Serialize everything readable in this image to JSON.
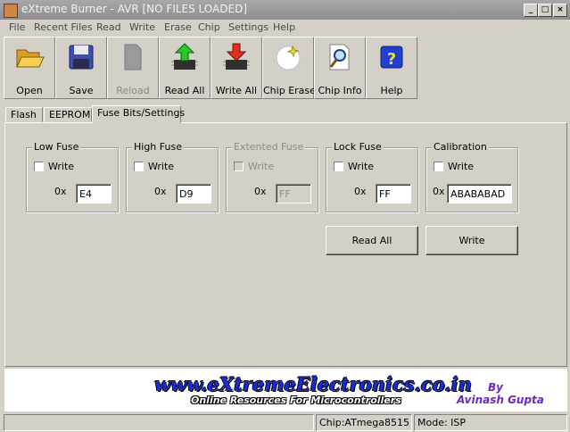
{
  "window": {
    "title": "eXtreme Burner - AVR [NO FILES LOADED]"
  },
  "menu": [
    "File",
    "Recent Files",
    "Read",
    "Write",
    "Erase",
    "Chip",
    "Settings",
    "Help"
  ],
  "toolbar": {
    "open": "Open",
    "save": "Save",
    "reload": "Reload",
    "read_all": "Read All",
    "write_all": "Write All",
    "chip_erase": "Chip Erase",
    "chip_info": "Chip Info",
    "help": "Help"
  },
  "tabs": [
    "Flash",
    "EEPROM",
    "Fuse Bits/Settings"
  ],
  "fuses": [
    {
      "title": "Low Fuse",
      "write_label": "Write",
      "prefix": "0x",
      "value": "E4",
      "enabled": true
    },
    {
      "title": "High Fuse",
      "write_label": "Write",
      "prefix": "0x",
      "value": "D9",
      "enabled": true
    },
    {
      "title": "Extented Fuse",
      "write_label": "Write",
      "prefix": "0x",
      "value": "FF",
      "enabled": false
    },
    {
      "title": "Lock Fuse",
      "write_label": "Write",
      "prefix": "0x",
      "value": "FF",
      "enabled": true
    },
    {
      "title": "Calibration",
      "write_label": "Write",
      "prefix": "0x",
      "value": "ABABABAD",
      "enabled": true
    }
  ],
  "actions": {
    "read_all": "Read All",
    "write": "Write"
  },
  "banner": {
    "url": "www.eXtremeElectronics.co.in",
    "tagline": "Online Resources For Microcontrollers",
    "by": "By",
    "author": "Avinash Gupta"
  },
  "status": {
    "chip": "Chip:ATmega8515",
    "mode": "Mode: ISP"
  },
  "colors": {
    "window_bg": "#d4d0c8",
    "banner_url": "#1b2bd6",
    "banner_author": "#6a28c8",
    "titlebar": "#9a9a9a"
  }
}
